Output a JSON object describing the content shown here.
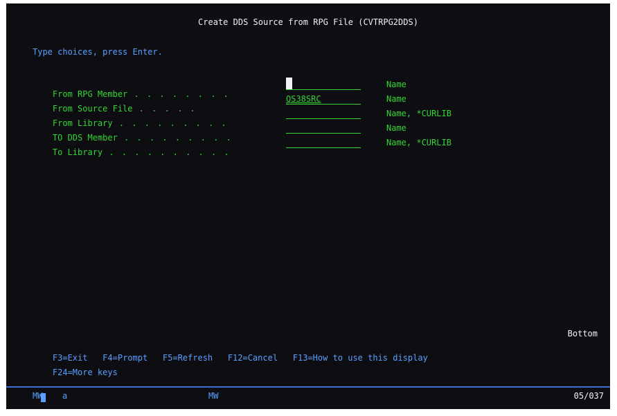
{
  "screen_title": "Create DDS Source from RPG File (CVTRPG2DDS)",
  "instruction": "Type choices, press Enter.",
  "prompts": [
    {
      "label": "From RPG Member",
      "value": "",
      "hint": "Name"
    },
    {
      "label": "From Source File",
      "value": "QS38SRC",
      "hint": "Name"
    },
    {
      "label": "From Library",
      "value": "",
      "hint": "Name, *CURLIB"
    },
    {
      "label": "TO DDS Member",
      "value": "",
      "hint": "Name"
    },
    {
      "label": "To Library",
      "value": "",
      "hint": "Name, *CURLIB"
    }
  ],
  "more_indicator": "Bottom",
  "function_keys_line1": [
    "F3=Exit",
    "F4=Prompt",
    "F5=Refresh",
    "F12=Cancel",
    "F13=How to use this display"
  ],
  "function_keys_line2": [
    "F24=More keys"
  ],
  "status_bar": {
    "session": "MW",
    "indicator": "a",
    "mode": "MW",
    "cursor_position": "05/037"
  },
  "colors": {
    "background": "#0d0d12",
    "green_text": "#33d633",
    "blue_text": "#5aa0ff",
    "white_text": "#f2f2f2"
  }
}
